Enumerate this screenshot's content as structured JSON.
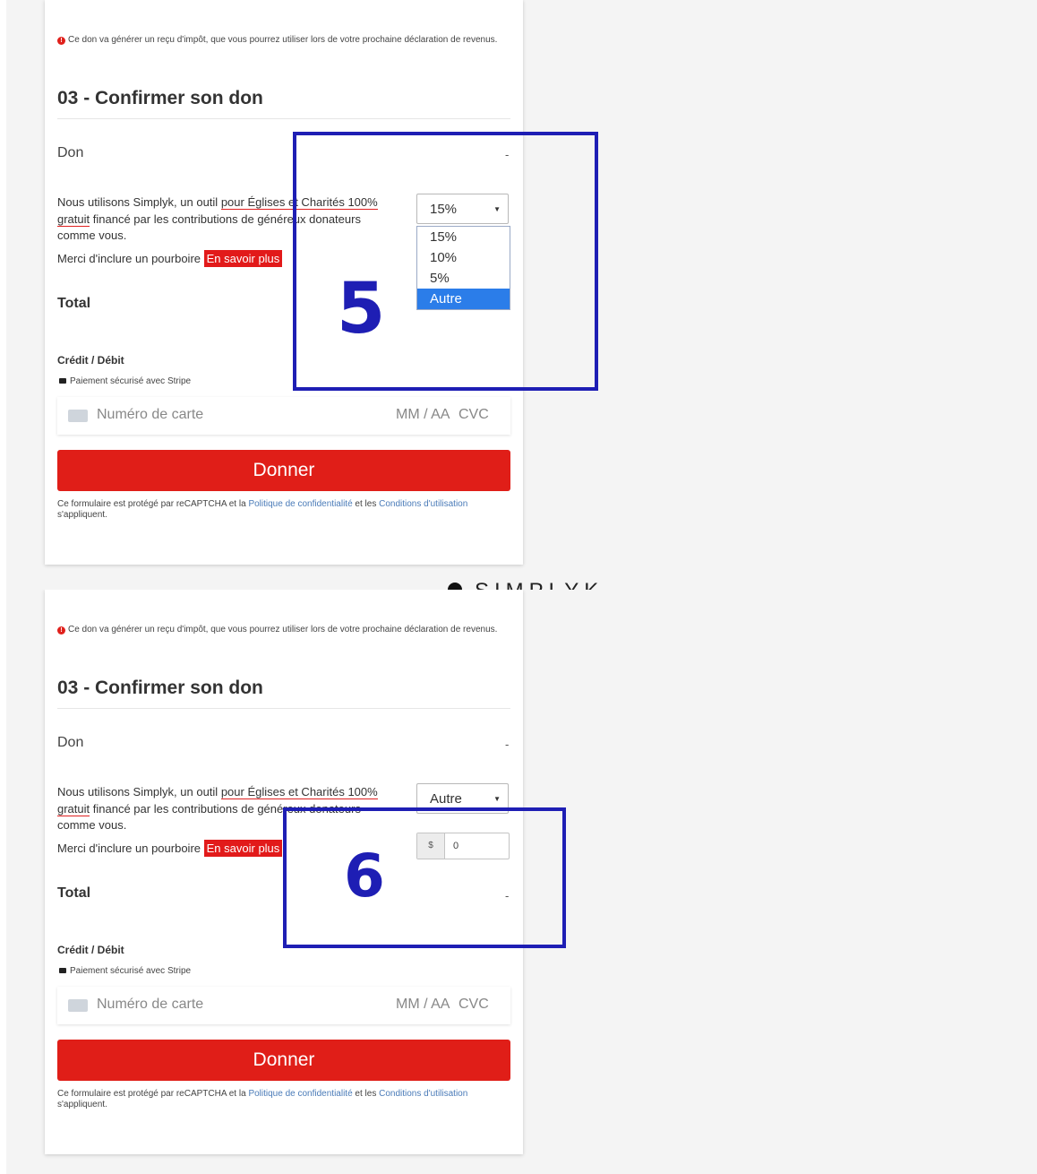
{
  "panels": [
    {
      "annotation_number": "5",
      "notice": "Ce don va générer un reçu d'impôt, que vous pourrez utiliser lors de votre prochaine déclaration de revenus.",
      "section_title": "03 - Confirmer son don",
      "don_label": "Don",
      "don_value": "-",
      "para_before": "Nous utilisons Simplyk, un outil",
      "para_link": "pour Églises et Charités 100% gratuit",
      "para_after": "financé par les contributions de généreux donateurs comme vous.",
      "tip_text": "Merci d'inclure un pourboire",
      "learn_more": "En savoir plus",
      "tip_select_value": "15%",
      "tip_options": [
        "15%",
        "10%",
        "5%",
        "Autre"
      ],
      "total_label": "Total",
      "total_value": "",
      "payment_title": "Crédit / Débit",
      "secure_text": "Paiement sécurisé avec Stripe",
      "card_placeholder": "Numéro de carte",
      "expiry_placeholder": "MM / AA",
      "cvc_placeholder": "CVC",
      "donate_button": "Donner",
      "legal_before": "Ce formulaire est protégé par reCAPTCHA et la",
      "legal_privacy": "Politique de confidentialité",
      "legal_mid": "et les",
      "legal_terms": "Conditions d'utilisation",
      "legal_after": "s'appliquent."
    },
    {
      "annotation_number": "6",
      "notice": "Ce don va générer un reçu d'impôt, que vous pourrez utiliser lors de votre prochaine déclaration de revenus.",
      "section_title": "03 - Confirmer son don",
      "don_label": "Don",
      "don_value": "-",
      "para_before": "Nous utilisons Simplyk, un outil",
      "para_link": "pour Églises et Charités 100% gratuit",
      "para_after": "financé par les contributions de généreux donateurs comme vous.",
      "tip_text": "Merci d'inclure un pourboire",
      "learn_more": "En savoir plus",
      "tip_select_value": "Autre",
      "custom_currency": "$",
      "custom_amount": "0",
      "total_label": "Total",
      "total_value": "-",
      "payment_title": "Crédit / Débit",
      "secure_text": "Paiement sécurisé avec Stripe",
      "card_placeholder": "Numéro de carte",
      "expiry_placeholder": "MM / AA",
      "cvc_placeholder": "CVC",
      "donate_button": "Donner",
      "legal_before": "Ce formulaire est protégé par reCAPTCHA et la",
      "legal_privacy": "Politique de confidentialité",
      "legal_mid": "et les",
      "legal_terms": "Conditions d'utilisation",
      "legal_after": "s'appliquent."
    }
  ],
  "brand": "SIMPLYK",
  "colors": {
    "accent_red": "#e01e18",
    "annotation_blue": "#1e1eb4",
    "highlight_blue": "#2b7de9",
    "link_blue": "#4a7bb8"
  }
}
